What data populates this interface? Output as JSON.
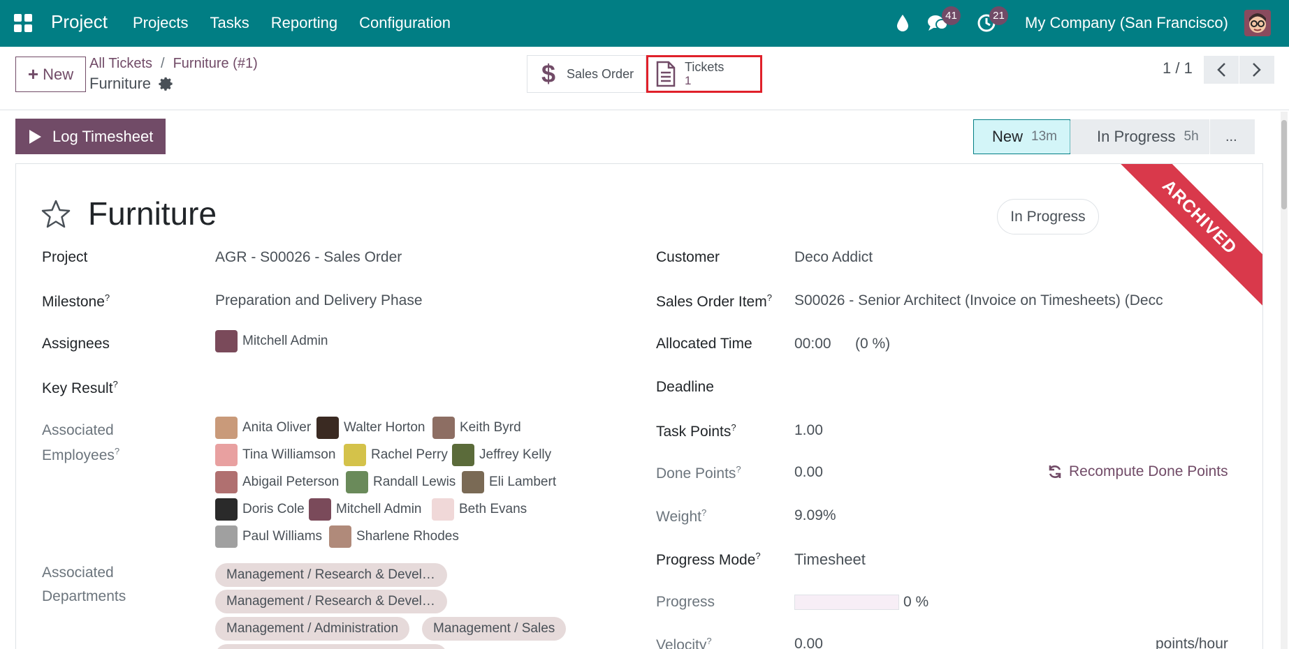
{
  "navbar": {
    "app_name": "Project",
    "menu": [
      "Projects",
      "Tasks",
      "Reporting",
      "Configuration"
    ],
    "messages_badge": "41",
    "activities_badge": "21",
    "company": "My Company (San Francisco)",
    "icons": [
      "apps-grid-icon",
      "droplet-icon",
      "chat-icon",
      "clock-icon"
    ]
  },
  "control_panel": {
    "new_label": "New",
    "breadcrumb_root": "All Tickets",
    "breadcrumb_sep": "/",
    "breadcrumb_parent": "Furniture (#1)",
    "record_name": "Furniture",
    "smart_sales_label": "Sales Order",
    "smart_tickets_label": "Tickets",
    "smart_tickets_count": "1",
    "pager": "1 / 1"
  },
  "actions": {
    "log_timesheet": "Log Timesheet"
  },
  "status_bar": {
    "stages": [
      {
        "label": "New",
        "duration": "13m"
      },
      {
        "label": "In Progress",
        "duration": "5h"
      }
    ],
    "more": "..."
  },
  "form": {
    "title": "Furniture",
    "stage_pill": "In Progress",
    "ribbon": "ARCHIVED",
    "left": {
      "project_label": "Project",
      "project_value": "AGR - S00026 - Sales Order",
      "milestone_label": "Milestone",
      "milestone_value": "Preparation and Delivery Phase",
      "assignees_label": "Assignees",
      "assignee": "Mitchell Admin",
      "key_result_label": "Key Result",
      "assoc_emp_label_1": "Associated",
      "assoc_emp_label_2": "Employees",
      "employees": [
        "Anita Oliver",
        "Walter Horton",
        "Keith Byrd",
        "Tina Williamson",
        "Rachel Perry",
        "Jeffrey Kelly",
        "Abigail Peterson",
        "Randall Lewis",
        "Eli Lambert",
        "Doris Cole",
        "Mitchell Admin",
        "Beth Evans",
        "Paul Williams",
        "Sharlene Rhodes"
      ],
      "assoc_dept_label_1": "Associated",
      "assoc_dept_label_2": "Departments",
      "departments": [
        "Management / Research & Devel…",
        "Management / Research & Devel…",
        "Management / Administration",
        "Management / Sales"
      ]
    },
    "right": {
      "customer_label": "Customer",
      "customer_value": "Deco Addict",
      "soi_label": "Sales Order Item",
      "soi_value": "S00026 - Senior Architect (Invoice on Timesheets) (Decc",
      "allocated_label": "Allocated Time",
      "allocated_value": "00:00",
      "allocated_pct": "(0 %)",
      "deadline_label": "Deadline",
      "task_points_label": "Task Points",
      "task_points_value": "1.00",
      "done_points_label": "Done Points",
      "done_points_value": "0.00",
      "recompute_label": "Recompute Done Points",
      "weight_label": "Weight",
      "weight_value": "9.09%",
      "progress_mode_label": "Progress Mode",
      "progress_mode_value": "Timesheet",
      "progress_label": "Progress",
      "progress_fraction": 0,
      "progress_text": "0 %",
      "velocity_label": "Velocity",
      "velocity_value": "0.00",
      "velocity_unit": "points/hour"
    },
    "help_mark": "?"
  },
  "colors": {
    "navbar": "#017e84",
    "primary": "#714b67",
    "ribbon": "#d9394b",
    "stage_active": "#d3f5f8"
  }
}
